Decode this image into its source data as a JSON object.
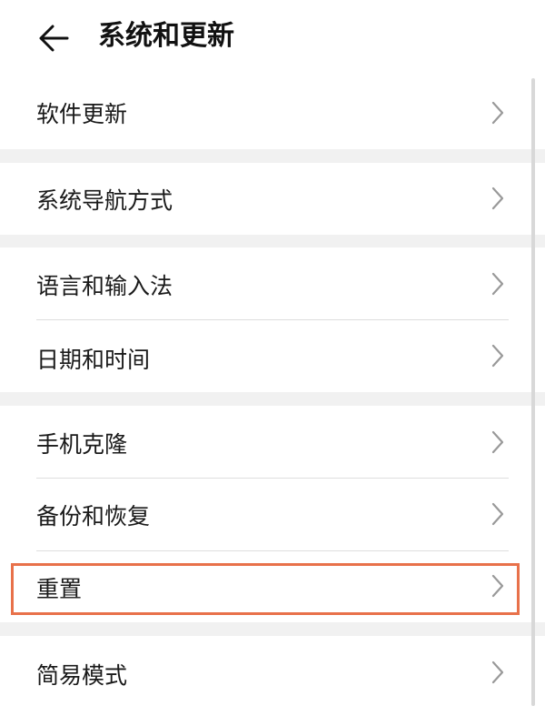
{
  "header": {
    "title": "系统和更新",
    "back_icon": "arrow-left-icon"
  },
  "groups": [
    {
      "items": [
        {
          "label": "软件更新"
        }
      ]
    },
    {
      "items": [
        {
          "label": "系统导航方式"
        }
      ]
    },
    {
      "items": [
        {
          "label": "语言和输入法"
        },
        {
          "label": "日期和时间"
        }
      ]
    },
    {
      "items": [
        {
          "label": "手机克隆"
        },
        {
          "label": "备份和恢复"
        },
        {
          "label": "重置",
          "highlighted": true
        }
      ]
    },
    {
      "items": [
        {
          "label": "简易模式"
        }
      ]
    }
  ],
  "colors": {
    "background": "#f1f1f1",
    "card": "#ffffff",
    "highlight": "#e8714a",
    "chevron": "#999999"
  },
  "icons": {
    "row_chevron": "chevron-right-icon"
  }
}
